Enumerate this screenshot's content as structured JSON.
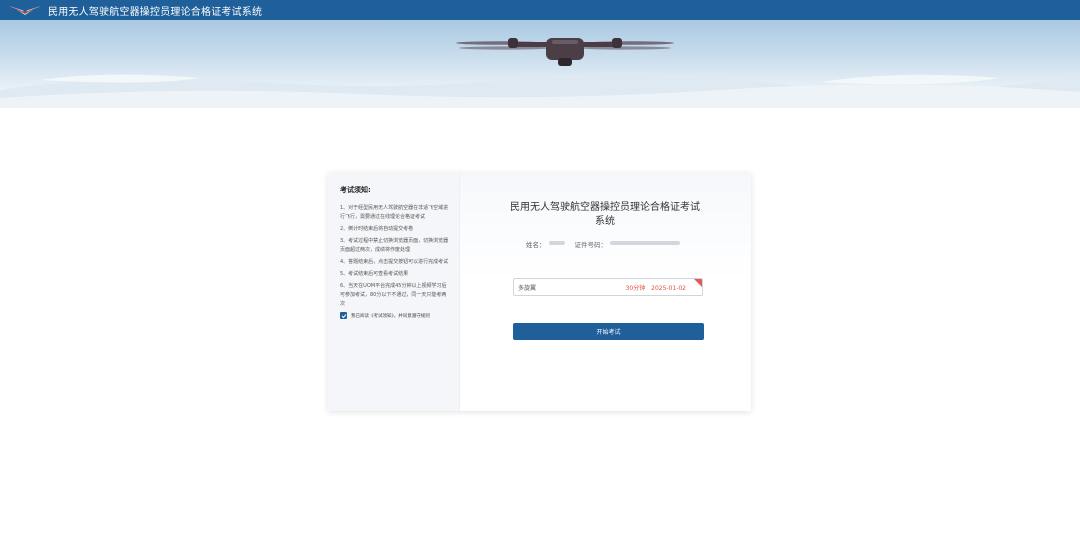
{
  "header": {
    "app_title": "民用无人驾驶航空器操控员理论合格证考试系统",
    "logo_icon": "wings-logo-icon",
    "bar_color": "#1f5f9a"
  },
  "banner": {
    "image": "drone-over-clouds"
  },
  "notice": {
    "title": "考试须知:",
    "items": [
      "1、对于经型民用无人驾驶航空器在非适飞空域进行飞行，需要通过在线理论合格证考试",
      "2、倒计时结束后将自动提交考卷",
      "3、考试过程中禁止切换浏览器页面，切换浏览器页面超过两次，成绩将作废处理",
      "4、答题结束后，点击提交按钮可以进行完成考试",
      "5、考试结束后可查看考试结果",
      "6、当天在UOM平台完成45分钟以上视频学习后可参加考试，80分以下不通过，同一天只能考两次"
    ],
    "agree_text": "我已阅读《考试须知》，并同意遵守规则",
    "agree_checked": true
  },
  "exam": {
    "system_title": "民用无人驾驶航空器操控员理论合格证考试系统",
    "name_label": "姓名：",
    "id_label": "证件号码：",
    "exam_name": "多旋翼",
    "duration": "30分钟",
    "date": "2025-01-02",
    "start_button": "开始考试",
    "accent_color": "#e0533d"
  }
}
